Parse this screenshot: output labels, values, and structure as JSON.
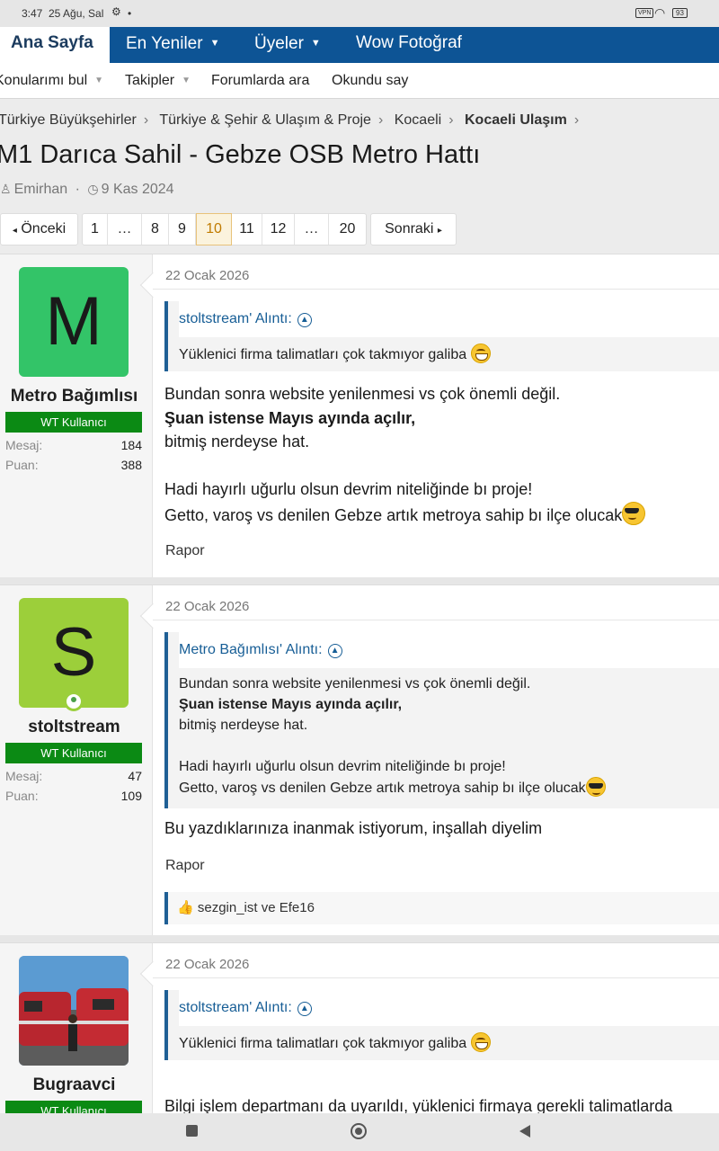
{
  "status": {
    "time": "3:47",
    "date": "25 Ağu, Sal",
    "vpn": "VPN",
    "battery": "93"
  },
  "nav": {
    "home": "Ana Sayfa",
    "latest": "En Yeniler",
    "members": "Üyeler",
    "wow": "Wow Fotoğraf"
  },
  "subnav": {
    "find_threads": "Konularımı bul",
    "watched": "Takipler",
    "search": "Forumlarda ara",
    "mark_read": "Okundu say"
  },
  "breadcrumb": [
    "Türkiye Büyükşehirler",
    "Türkiye & Şehir & Ulaşım & Proje",
    "Kocaeli",
    "Kocaeli Ulaşım"
  ],
  "thread": {
    "title": "M1 Darıca Sahil - Gebze OSB Metro Hattı",
    "author": "Emirhan",
    "date": "9 Kas 2024"
  },
  "pager": {
    "prev": "Önceki",
    "next": "Sonraki",
    "pages": [
      "1",
      "…",
      "8",
      "9",
      "10",
      "11",
      "12",
      "…",
      "20"
    ],
    "current": "10"
  },
  "labels": {
    "messages": "Mesaj:",
    "points": "Puan:",
    "report": "Rapor",
    "quote_suffix": "' Alıntı:"
  },
  "posts": [
    {
      "user": {
        "name": "Metro Bağımlısı",
        "initial": "M",
        "avatar_color": "#33c468",
        "role": "WT Kullanıcı",
        "messages": "184",
        "points": "388"
      },
      "date": "22 Ocak 2026",
      "quote": {
        "author": "stoltstream",
        "text": "Yüklenici firma talimatları çok takmıyor galiba"
      },
      "lines": [
        "Bundan sonra website yenilenmesi vs çok önemli değil.",
        "Şuan istense Mayıs ayında açılır,",
        "bitmiş nerdeyse hat.",
        "",
        "Hadi hayırlı uğurlu olsun devrim niteliğinde bı proje!",
        "Getto, varoş vs denilen Gebze artık metroya sahip bı ilçe olucak"
      ]
    },
    {
      "user": {
        "name": "stoltstream",
        "initial": "S",
        "avatar_color": "#9ccf3a",
        "role": "WT Kullanıcı",
        "messages": "47",
        "points": "109"
      },
      "date": "22 Ocak 2026",
      "quote": {
        "author": "Metro Bağımlısı",
        "lines": [
          "Bundan sonra website yenilenmesi vs çok önemli değil.",
          "Şuan istense Mayıs ayında açılır,",
          "bitmiş nerdeyse hat.",
          "",
          "Hadi hayırlı uğurlu olsun devrim niteliğinde bı proje!",
          "Getto, varoş vs denilen Gebze artık metroya sahip bı ilçe olucak"
        ]
      },
      "text": "Bu yazdıklarınıza inanmak istiyorum, inşallah diyelim",
      "reactions": "sezgin_ist ve Efe16"
    },
    {
      "user": {
        "name": "Bugraavci",
        "role": "WT Kullanıcı"
      },
      "date": "22 Ocak 2026",
      "quote": {
        "author": "stoltstream",
        "text": "Yüklenici firma talimatları çok takmıyor galiba"
      },
      "text": "Bilgi işlem departmanı da uyarıldı, yüklenici firmaya gerekli talimatlarda"
    }
  ]
}
